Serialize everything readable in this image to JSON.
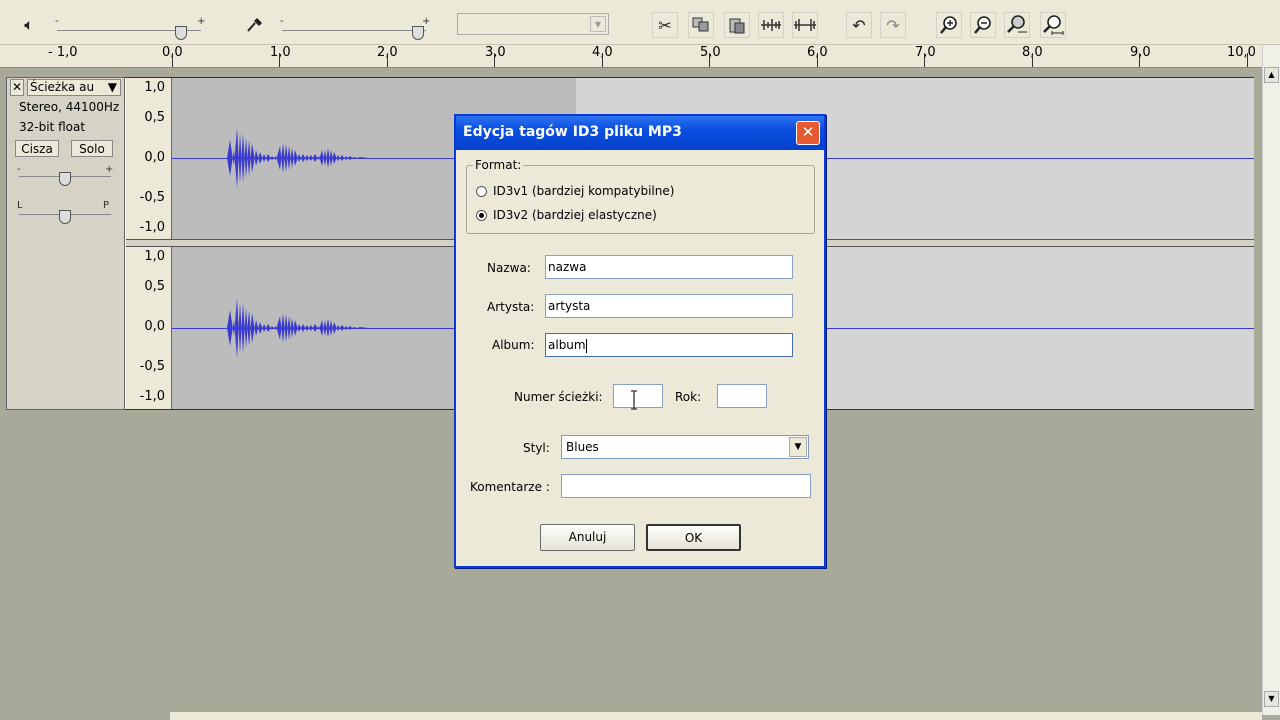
{
  "toolbar": {
    "icons": [
      "speaker-icon",
      "mic-icon",
      "cut-icon",
      "copy-icon",
      "paste-icon",
      "trim-icon",
      "silence-icon",
      "undo-icon",
      "redo-icon",
      "zoom-in-icon",
      "zoom-out-icon",
      "zoom-fit-icon",
      "zoom-sel-icon"
    ]
  },
  "ruler": {
    "ticks": [
      "- 1,0",
      "0,0",
      "1,0",
      "2,0",
      "3,0",
      "4,0",
      "5,0",
      "6,0",
      "7,0",
      "8,0",
      "9,0",
      "10,0"
    ]
  },
  "track": {
    "close_glyph": "✕",
    "name": "Ścieżka au",
    "menu_glyph": "▼",
    "info_line1": "Stereo, 44100Hz",
    "info_line2": "32-bit float",
    "mute_label": "Cisza",
    "solo_label": "Solo",
    "gain_minus": "-",
    "gain_plus": "+",
    "pan_left": "L",
    "pan_right": "P",
    "y_labels": [
      "1,0",
      "0,5",
      "0,0",
      "-0,5",
      "-1,0"
    ]
  },
  "dialog": {
    "title": "Edycja tagów ID3 pliku MP3",
    "close_glyph": "✕",
    "format_legend": "Format:",
    "option_v1": "ID3v1 (bardziej kompatybilne)",
    "option_v2": "ID3v2 (bardziej elastyczne)",
    "selected_format": "ID3v2",
    "name_label": "Nazwa:",
    "name_value": "nazwa",
    "artist_label": "Artysta:",
    "artist_value": "artysta",
    "album_label": "Album:",
    "album_value": "album",
    "track_label": "Numer ścieżki:",
    "track_value": "",
    "year_label": "Rok:",
    "year_value": "",
    "genre_label": "Styl:",
    "genre_value": "Blues",
    "comments_label": "Komentarze :",
    "comments_value": "",
    "cancel_label": "Anuluj",
    "ok_label": "OK"
  },
  "colors": {
    "waveform": "#3b3bd0",
    "title_bar": "#0a4fe0",
    "close_button": "#e55a2e"
  }
}
